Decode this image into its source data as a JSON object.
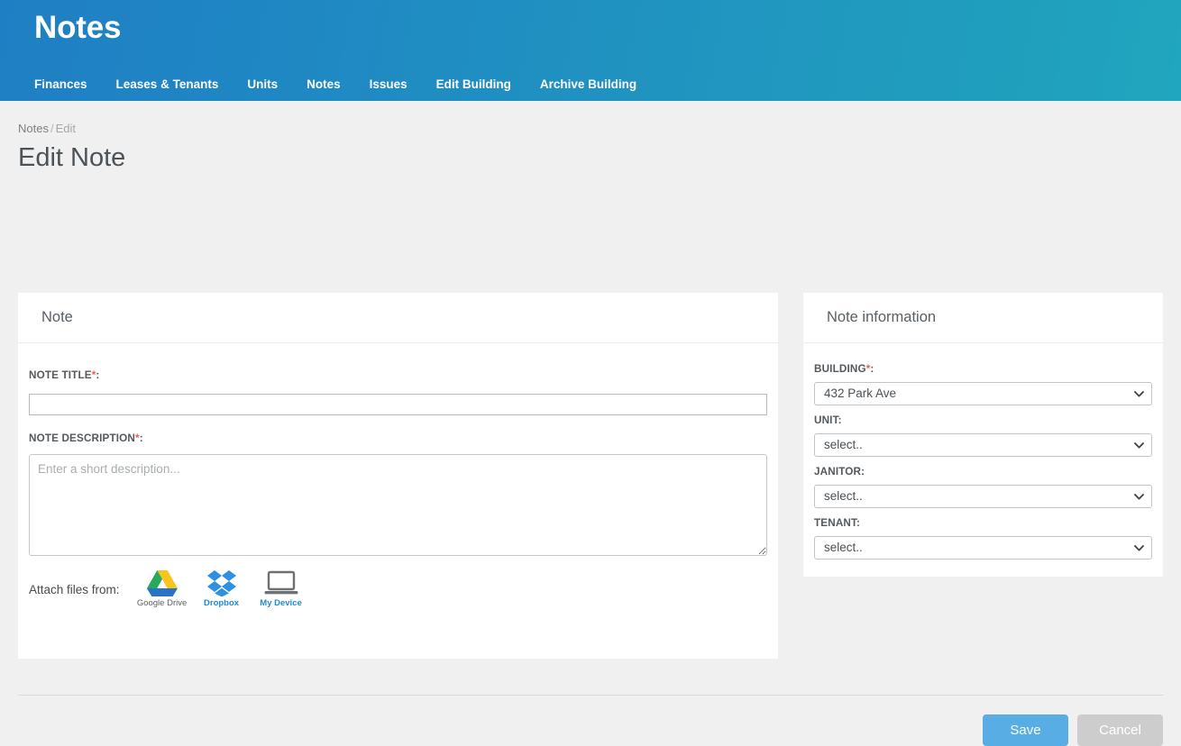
{
  "header": {
    "title": "Notes",
    "nav": [
      {
        "label": "Finances",
        "name": "nav-finances"
      },
      {
        "label": "Leases & Tenants",
        "name": "nav-leases-tenants"
      },
      {
        "label": "Units",
        "name": "nav-units"
      },
      {
        "label": "Notes",
        "name": "nav-notes"
      },
      {
        "label": "Issues",
        "name": "nav-issues"
      },
      {
        "label": "Edit Building",
        "name": "nav-edit-building"
      },
      {
        "label": "Archive Building",
        "name": "nav-archive-building"
      }
    ],
    "gradient_from": "#1f7fc4",
    "gradient_to": "#21a6bf"
  },
  "breadcrumb": {
    "parent": "Notes",
    "separator": "/",
    "current": "Edit"
  },
  "page_title": "Edit Note",
  "note_card": {
    "heading": "Note",
    "fields": {
      "title": {
        "label": "NOTE TITLE",
        "required_marker": "*",
        "colon": ":",
        "value": "",
        "placeholder": ""
      },
      "description": {
        "label": "NOTE DESCRIPTION",
        "required_marker": "*",
        "colon": ":",
        "value": "",
        "placeholder": "Enter a short description..."
      }
    },
    "attach": {
      "label": "Attach files from:",
      "sources": [
        {
          "caption": "Google Drive",
          "icon": "google-drive-icon",
          "color": "#5c5f62"
        },
        {
          "caption": "Dropbox",
          "icon": "dropbox-icon",
          "color": "#1e8ae0"
        },
        {
          "caption": "My Device",
          "icon": "laptop-icon",
          "color": "#1e8ae0"
        }
      ]
    }
  },
  "info_card": {
    "heading": "Note information",
    "selects": [
      {
        "label": "BUILDING",
        "required_marker": "*",
        "colon": ":",
        "value": "432 Park Ave"
      },
      {
        "label": "UNIT",
        "required_marker": "",
        "colon": ":",
        "value": "select.."
      },
      {
        "label": "JANITOR",
        "required_marker": "",
        "colon": ":",
        "value": "select.."
      },
      {
        "label": "TENANT",
        "required_marker": "",
        "colon": ":",
        "value": "select.."
      }
    ]
  },
  "footer": {
    "save_label": "Save",
    "cancel_label": "Cancel",
    "save_color": "#57ade4",
    "cancel_color": "#cdcdcd"
  }
}
